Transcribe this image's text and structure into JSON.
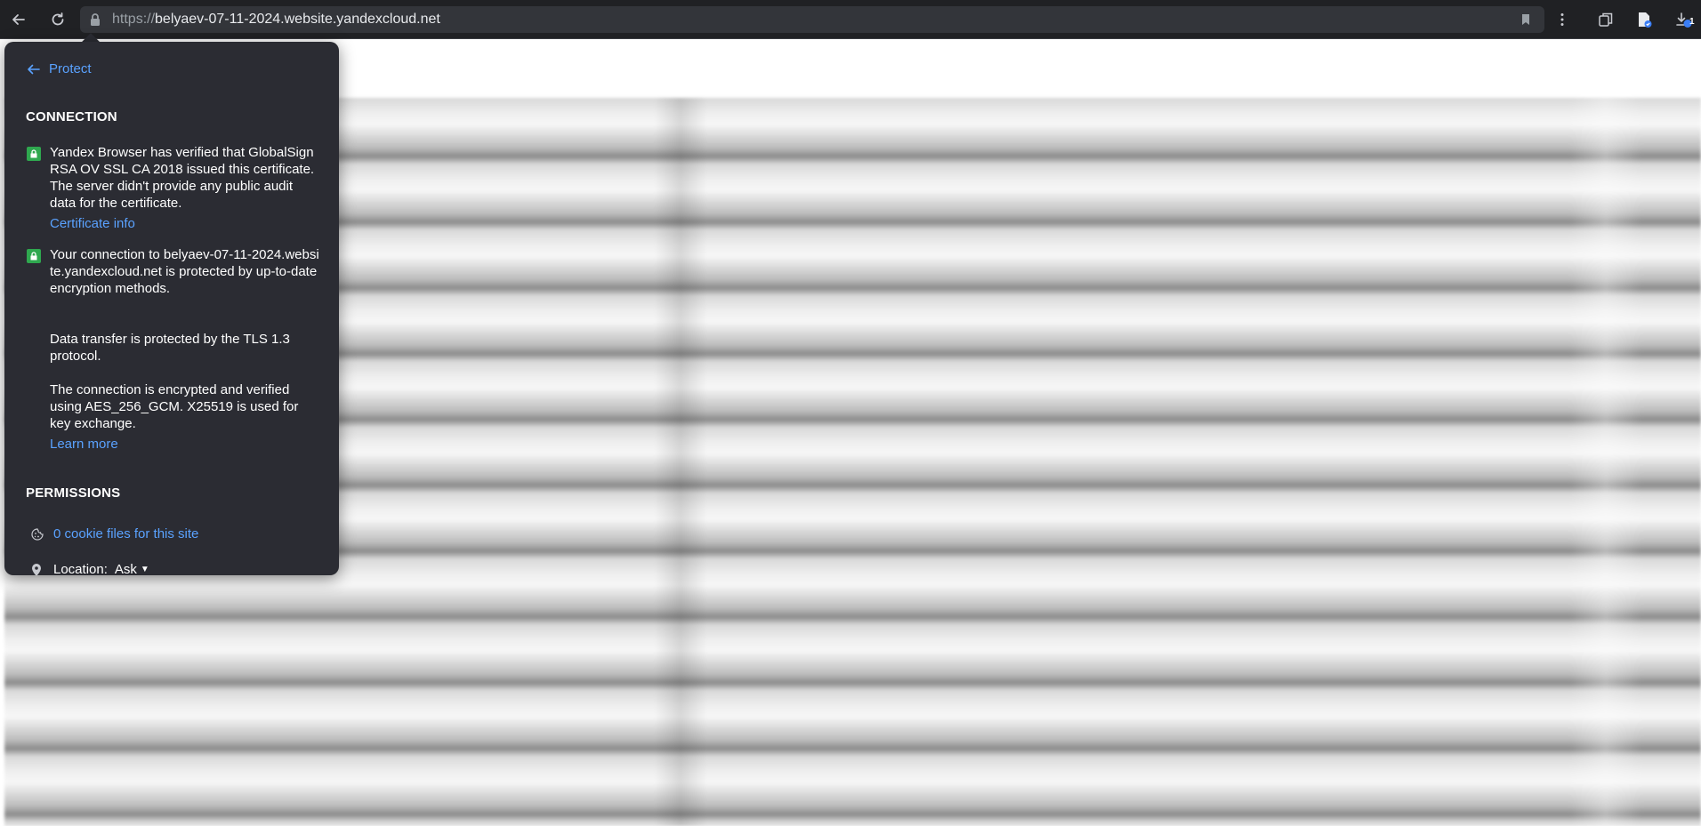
{
  "toolbar": {
    "url_scheme": "https://",
    "url_host": "belyaev-07-11-2024.website.yandexcloud.net",
    "download_badge_count": "1"
  },
  "popup": {
    "back_label": "Protect",
    "connection": {
      "title": "CONNECTION",
      "certificate_text": "Yandex Browser has verified that GlobalSign RSA OV SSL CA 2018 issued this certificate. The server didn't provide any public audit data for the certificate.",
      "certificate_link": "Certificate info",
      "connection_text": "Your connection to belyaev-07-11-2024.website.yandexcloud.net is protected by up-to-date encryption methods.",
      "tls_text": "Data transfer is protected by the TLS 1.3 protocol.",
      "cipher_text": "The connection is encrypted and verified using AES_256_GCM. X25519 is used for key exchange.",
      "learn_more": "Learn more"
    },
    "permissions": {
      "title": "PERMISSIONS",
      "cookies_link": "0 cookie files for this site",
      "location_label": "Location:",
      "location_value": "Ask"
    }
  },
  "colors": {
    "toolbar_bg": "#202124",
    "popup_bg": "#2b2c33",
    "link": "#5aa2ff",
    "secure_green": "#2fa84f"
  }
}
